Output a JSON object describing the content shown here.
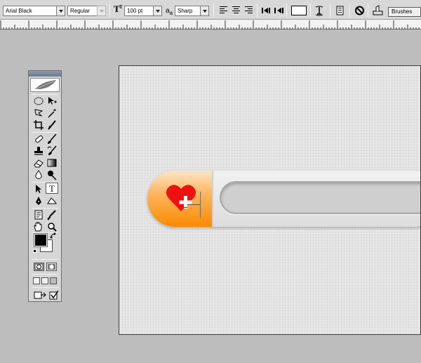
{
  "options_bar": {
    "font_family": "Arial Black",
    "font_style": "Regular",
    "font_size": "100 pt",
    "aa_label": "a",
    "aa_sub": "a",
    "antialias": "Sharp",
    "brushes_tab": "Brushes"
  },
  "icons": {
    "text_orientation": "text-orientation-icon",
    "font_size": "font-size-icon",
    "align_left": "align-left-icon",
    "align_center": "align-center-icon",
    "align_right": "align-right-icon",
    "warp": "warp-text-icon",
    "cancel": "cancel-icon",
    "commit": "commit-icon"
  },
  "toolbox": {
    "text_tool_glyph": "T",
    "selected_tool": "type-tool",
    "foreground_color": "#000000",
    "background_color": "#ffffff"
  },
  "canvas": {
    "orange_top": "#fde6c8",
    "orange_bottom": "#fb8a00",
    "heart_color": "#ee1111"
  }
}
